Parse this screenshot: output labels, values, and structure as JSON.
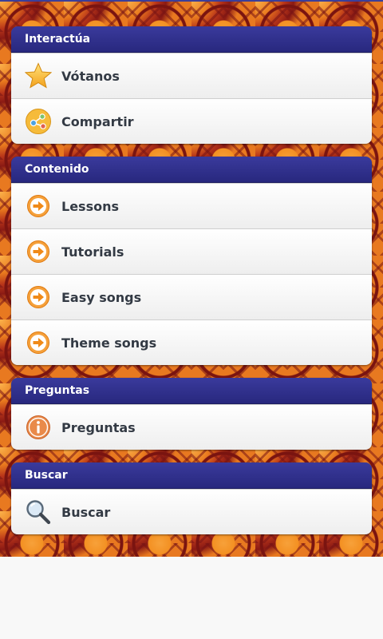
{
  "sections": [
    {
      "title": "Interactúa",
      "items": [
        {
          "label": "Vótanos",
          "icon": "star-icon"
        },
        {
          "label": "Compartir",
          "icon": "share-icon"
        }
      ]
    },
    {
      "title": "Contenido",
      "items": [
        {
          "label": "Lessons",
          "icon": "arrow-right-icon"
        },
        {
          "label": "Tutorials",
          "icon": "arrow-right-icon"
        },
        {
          "label": "Easy songs",
          "icon": "arrow-right-icon"
        },
        {
          "label": "Theme songs",
          "icon": "arrow-right-icon"
        }
      ]
    },
    {
      "title": "Preguntas",
      "items": [
        {
          "label": "Preguntas",
          "icon": "info-icon"
        }
      ]
    },
    {
      "title": "Buscar",
      "items": [
        {
          "label": "Buscar",
          "icon": "search-icon"
        }
      ]
    }
  ],
  "colors": {
    "header": "#2e2e8c",
    "item_text": "#333a44",
    "accent_orange": "#f39022",
    "background_bottom": "#f8f8f8"
  }
}
